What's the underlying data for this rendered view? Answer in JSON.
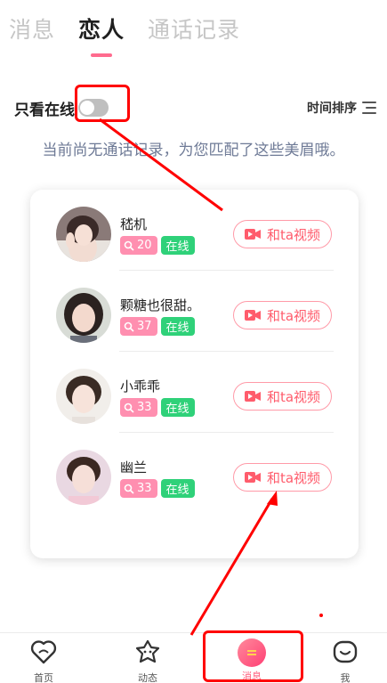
{
  "tabs": [
    {
      "label": "消息",
      "active": false
    },
    {
      "label": "恋人",
      "active": true
    },
    {
      "label": "通话记录",
      "active": false
    }
  ],
  "filter": {
    "online_only_label": "只看在线",
    "online_only_enabled": false,
    "sort_label": "时间排序"
  },
  "hint": "当前尚无通话记录，为您匹配了这些美眉哦。",
  "users": [
    {
      "name": "嵇机",
      "level": "20",
      "status": "在线",
      "video_label": "和ta视频"
    },
    {
      "name": "颗糖也很甜。",
      "level": "37",
      "status": "在线",
      "video_label": "和ta视频"
    },
    {
      "name": "小乖乖",
      "level": "33",
      "status": "在线",
      "video_label": "和ta视频"
    },
    {
      "name": "幽兰",
      "level": "33",
      "status": "在线",
      "video_label": "和ta视频"
    }
  ],
  "bottom_nav": [
    {
      "label": "首页",
      "icon": "heart-chat-icon",
      "active": false
    },
    {
      "label": "动态",
      "icon": "star-face-icon",
      "active": false
    },
    {
      "label": "消息",
      "icon": "message-bubble-icon",
      "active": true
    },
    {
      "label": "我",
      "icon": "smile-face-icon",
      "active": false
    }
  ],
  "colors": {
    "accent": "#ff6b8e",
    "online_green": "#2fd179",
    "level_pink": "#ff8fb0",
    "annotation_red": "#ff0000"
  }
}
